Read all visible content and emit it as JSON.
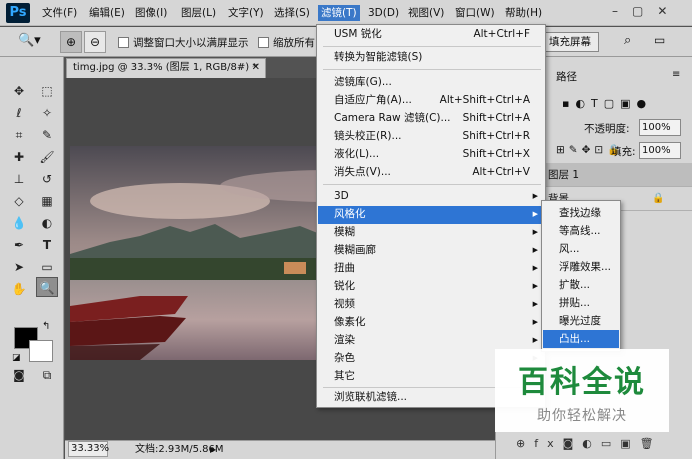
{
  "app": {
    "logo": "Ps"
  },
  "menubar": {
    "items": [
      "文件(F)",
      "编辑(E)",
      "图像(I)",
      "图层(L)",
      "文字(Y)",
      "选择(S)",
      "滤镜(T)",
      "3D(D)",
      "视图(V)",
      "窗口(W)",
      "帮助(H)"
    ]
  },
  "options": {
    "resize_windows": "调整窗口大小以满屏显示",
    "zoom_all": "缩放所有",
    "fill_screen": "填充屏幕"
  },
  "document": {
    "tab_title": "timg.jpg @ 33.3% (图层 1, RGB/8#) *",
    "zoom": "33.33%",
    "doc_info": "文档:2.93M/5.86M"
  },
  "panel": {
    "tab_paths": "路径",
    "opacity_label": "不透明度:",
    "opacity_value": "100%",
    "fill_label": "填充:",
    "fill_value": "100%",
    "layers": [
      "图层 1",
      "背景"
    ]
  },
  "filter_menu": {
    "items": [
      {
        "label": "USM 锐化",
        "shortcut": "Alt+Ctrl+F"
      },
      {
        "label": "转换为智能滤镜(S)",
        "shortcut": ""
      },
      {
        "label": "滤镜库(G)...",
        "shortcut": ""
      },
      {
        "label": "自适应广角(A)...",
        "shortcut": "Alt+Shift+Ctrl+A"
      },
      {
        "label": "Camera Raw 滤镜(C)...",
        "shortcut": "Shift+Ctrl+A"
      },
      {
        "label": "镜头校正(R)...",
        "shortcut": "Shift+Ctrl+R"
      },
      {
        "label": "液化(L)...",
        "shortcut": "Shift+Ctrl+X"
      },
      {
        "label": "消失点(V)...",
        "shortcut": "Alt+Ctrl+V"
      },
      {
        "label": "3D",
        "shortcut": ""
      },
      {
        "label": "风格化",
        "shortcut": ""
      },
      {
        "label": "模糊",
        "shortcut": ""
      },
      {
        "label": "模糊画廊",
        "shortcut": ""
      },
      {
        "label": "扭曲",
        "shortcut": ""
      },
      {
        "label": "锐化",
        "shortcut": ""
      },
      {
        "label": "视频",
        "shortcut": ""
      },
      {
        "label": "像素化",
        "shortcut": ""
      },
      {
        "label": "渲染",
        "shortcut": ""
      },
      {
        "label": "杂色",
        "shortcut": ""
      },
      {
        "label": "其它",
        "shortcut": ""
      },
      {
        "label": "浏览联机滤镜...",
        "shortcut": ""
      }
    ]
  },
  "stylize_menu": {
    "items": [
      "查找边缘",
      "等高线...",
      "风...",
      "浮雕效果...",
      "扩散...",
      "拼贴...",
      "曝光过度",
      "凸出..."
    ]
  },
  "watermark": {
    "title": "百科全说",
    "subtitle": "助你轻松解决"
  }
}
